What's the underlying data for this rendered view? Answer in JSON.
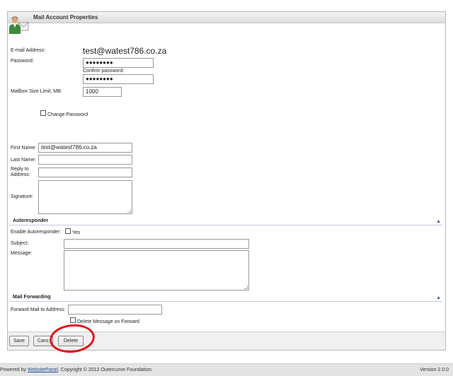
{
  "panel": {
    "title": "Mail Account Properties"
  },
  "account": {
    "email_label": "E-mail Address:",
    "email_value": "test@watest786.co.za",
    "password_label": "Password:",
    "password_value": "●●●●●●●●",
    "confirm_label": "Confirm password:",
    "confirm_value": "●●●●●●●●",
    "mailbox_label": "Mailbox Size Limit, MB:",
    "mailbox_value": "1000",
    "change_password_label": "Change Password",
    "change_password_checked": false
  },
  "profile": {
    "first_name_label": "First Name:",
    "first_name_value": "test@watest786.co.za",
    "last_name_label": "Last Name:",
    "last_name_value": "",
    "reply_label_1": "Reply to",
    "reply_label_2": "Address:",
    "reply_value": "",
    "signature_label": "Signature:"
  },
  "autoresponder": {
    "section_title": "Autoresponder",
    "enable_label": "Enable Autoresponder:",
    "yes_label": "Yes",
    "enabled": false,
    "subject_label": "Subject:",
    "subject_value": "",
    "message_label": "Message:"
  },
  "forwarding": {
    "section_title": "Mail Forwarding",
    "forward_label": "Forward Mail to Address:",
    "forward_value": "",
    "delete_on_forward_label": "Delete Message on Forward",
    "delete_on_forward_checked": false
  },
  "buttons": {
    "save": "Save",
    "cancel": "Canc",
    "delete": "Delete"
  },
  "footer": {
    "prefix": "Powered by ",
    "link": "WebsitePanel",
    "suffix": ". Copyright © 2012 Outercurve Foundation.",
    "version": "Version 2.0.0"
  },
  "colors": {
    "accent_link": "#1a4e9a",
    "annotation_circle": "#e5141a",
    "section_rule": "#c8c8e8"
  }
}
